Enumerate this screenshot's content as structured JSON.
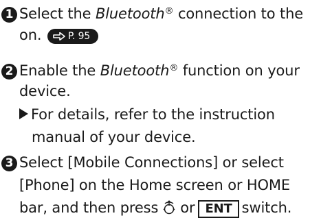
{
  "steps": [
    {
      "number": "1",
      "text_before": "Select the ",
      "italic": "Bluetooth",
      "registered": "®",
      "text_after": " connection to the",
      "line2": "on.",
      "xref": "P. 95"
    },
    {
      "number": "2",
      "text_before": "Enable the ",
      "italic": "Bluetooth",
      "registered": "®",
      "text_after": " function on your",
      "line2": "device.",
      "note_line1": "For details, refer to the instruction",
      "note_line2": "manual of your device."
    },
    {
      "number": "3",
      "line1": "Select [Mobile Connections] or select",
      "line2": "[Phone] on the Home screen or HOME",
      "line3_before": "bar, and then press",
      "line3_or": "or",
      "ent_label": "ENT",
      "line3_after": "switch."
    }
  ],
  "icons": {
    "xref_arrow": "right-arrow-icon",
    "note_marker": "triangle-bullet-icon",
    "dial": "selector-dial-icon"
  },
  "colors": {
    "text": "#1a1a1a",
    "badge_text": "#ffffff"
  }
}
